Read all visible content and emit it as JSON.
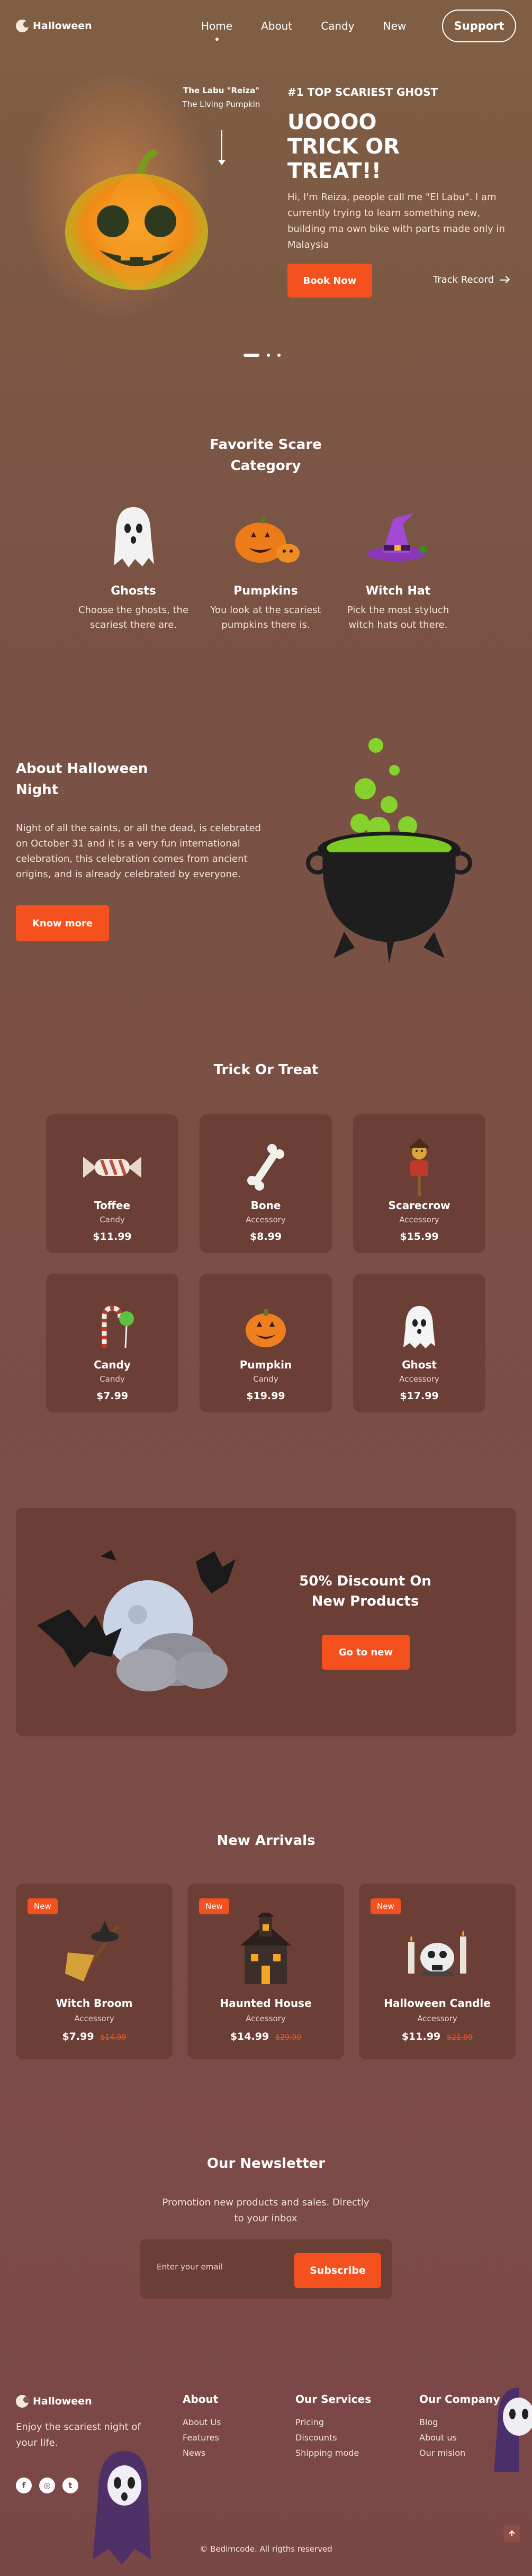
{
  "brand": {
    "name": "Halloween"
  },
  "nav": {
    "items": [
      "Home",
      "About",
      "Candy",
      "New"
    ],
    "support_label": "Support"
  },
  "hero": {
    "tag_title": "The Labu \"Reiza\"",
    "tag_subtitle": "The Living Pumpkin",
    "kicker": "#1 TOP SCARIEST GHOST",
    "title": "UOOOO TRICK OR TREAT!!",
    "description": "Hi, I'm Reiza, people call me \"El Labu\". I am currently trying to learn something new, building ma own bike with parts made only in Malaysia",
    "book_label": "Book Now",
    "track_label": "Track Record"
  },
  "category": {
    "title": "Favorite Scare Category",
    "items": [
      {
        "name": "Ghosts",
        "desc": "Choose the ghosts, the scariest there are.",
        "icon": "ghost-icon"
      },
      {
        "name": "Pumpkins",
        "desc": "You look at the scariest pumpkins there is.",
        "icon": "pumpkin-icon"
      },
      {
        "name": "Witch Hat",
        "desc": "Pick the most styluch witch hats out there.",
        "icon": "witch-hat-icon"
      }
    ]
  },
  "about": {
    "title": "About Halloween Night",
    "description": "Night of all the saints, or all the dead, is celebrated on October 31 and it is a very fun international celebration, this celebration comes from ancient origins, and is already celebrated by everyone.",
    "button_label": "Know more"
  },
  "trick_or_treat": {
    "title": "Trick Or Treat",
    "items": [
      {
        "name": "Toffee",
        "category": "Candy",
        "price": "$11.99",
        "icon": "toffee-icon"
      },
      {
        "name": "Bone",
        "category": "Accessory",
        "price": "$8.99",
        "icon": "bone-icon"
      },
      {
        "name": "Scarecrow",
        "category": "Accessory",
        "price": "$15.99",
        "icon": "scarecrow-icon"
      },
      {
        "name": "Candy",
        "category": "Candy",
        "price": "$7.99",
        "icon": "candy-icon"
      },
      {
        "name": "Pumpkin",
        "category": "Candy",
        "price": "$19.99",
        "icon": "pumpkin-icon"
      },
      {
        "name": "Ghost",
        "category": "Accessory",
        "price": "$17.99",
        "icon": "ghost-icon"
      }
    ]
  },
  "discount": {
    "title": "50% Discount On New Products",
    "button_label": "Go to new"
  },
  "new_arrivals": {
    "title": "New Arrivals",
    "items": [
      {
        "badge": "New",
        "name": "Witch Broom",
        "category": "Accessory",
        "price": "$7.99",
        "old_price": "$14.99",
        "icon": "broom-icon"
      },
      {
        "badge": "New",
        "name": "Haunted House",
        "category": "Accessory",
        "price": "$14.99",
        "old_price": "$29.99",
        "icon": "haunted-house-icon"
      },
      {
        "badge": "New",
        "name": "Halloween Candle",
        "category": "Accessory",
        "price": "$11.99",
        "old_price": "$21.99",
        "icon": "candle-icon"
      }
    ]
  },
  "newsletter": {
    "title": "Our Newsletter",
    "description": "Promotion new products and sales. Directly to your inbox",
    "placeholder": "Enter your email",
    "button_label": "Subscribe"
  },
  "footer": {
    "brand": "Halloween",
    "description": "Enjoy the scariest night of your life.",
    "socials": [
      "f",
      "◎",
      "t"
    ],
    "columns": [
      {
        "title": "About",
        "links": [
          "About Us",
          "Features",
          "News"
        ]
      },
      {
        "title": "Our Services",
        "links": [
          "Pricing",
          "Discounts",
          "Shipping mode"
        ]
      },
      {
        "title": "Our Company",
        "links": [
          "Blog",
          "About us",
          "Our mision"
        ]
      }
    ],
    "copyright": "© Bedimcode. All rigths reserved"
  },
  "colors": {
    "accent": "#f4511e",
    "card": "#6b3f36"
  }
}
